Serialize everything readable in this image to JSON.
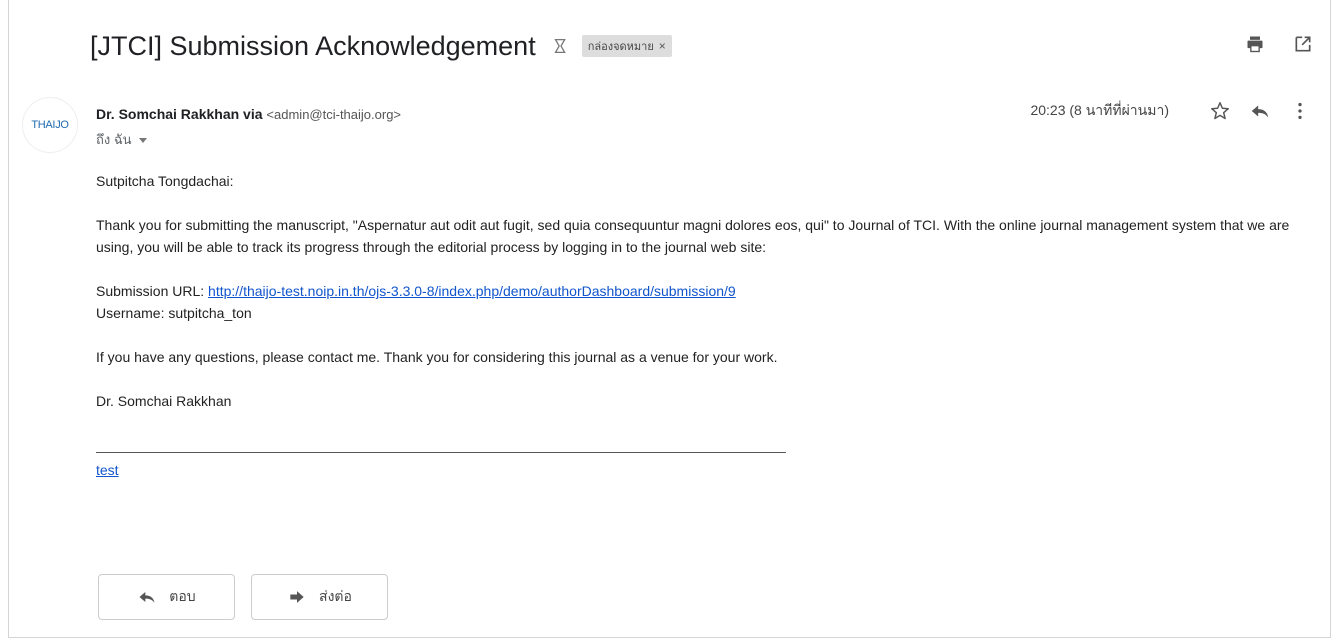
{
  "subject": "[JTCI] Submission Acknowledgement",
  "label": "กล่องจดหมาย",
  "label_remove": "×",
  "avatar": {
    "text_a": "THAI",
    "text_b": "JO"
  },
  "sender": {
    "name": "Dr. Somchai Rakkhan via",
    "email": "<admin@tci-thaijo.org>"
  },
  "recipient": "ถึง ฉัน",
  "timestamp": "20:23 (8 นาทีที่ผ่านมา)",
  "body": {
    "greeting": "Sutpitcha Tongdachai:",
    "paragraph1": "Thank you for submitting the manuscript, \"Aspernatur aut odit aut fugit, sed quia consequuntur magni dolores eos, qui\" to Journal of TCI. With the online journal management system that we are using, you will be able to track its progress through the editorial process by logging in to the journal web site:",
    "submission_url_label": "Submission URL: ",
    "submission_url": "http://thaijo-test.noip.in.th/ojs-3.3.0-8/index.php/demo/authorDashboard/submission/9",
    "username_line": "Username: sutpitcha_ton",
    "paragraph3": "If you have any questions, please contact me. Thank you for considering this journal as a venue for your work.",
    "signature": "Dr. Somchai Rakkhan",
    "footer_link": "test"
  },
  "actions": {
    "reply": "ตอบ",
    "forward": "ส่งต่อ"
  },
  "icons": {
    "important": "important-marker-icon",
    "print": "print-icon",
    "new_window": "open-in-new-window-icon",
    "star": "star-icon",
    "reply": "reply-icon",
    "more": "more-vertical-icon",
    "forward": "forward-icon"
  }
}
